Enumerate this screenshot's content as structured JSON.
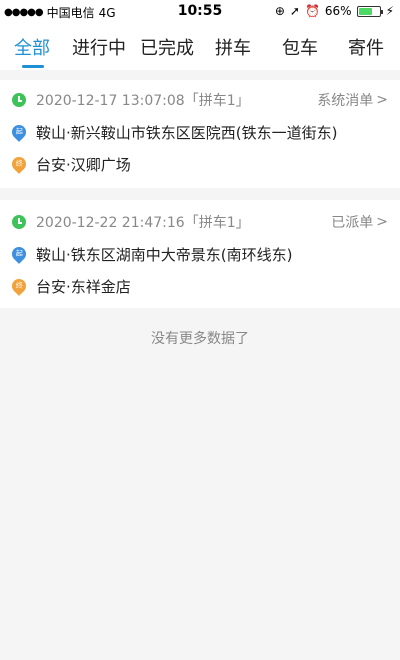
{
  "status_bar": {
    "signal_dots": "●●●●●",
    "carrier": "中国电信",
    "network": "4G",
    "time": "10:55",
    "battery": "66%",
    "battery_level": 0.66
  },
  "tabs": [
    {
      "label": "全部",
      "active": true
    },
    {
      "label": "进行中"
    },
    {
      "label": "已完成"
    },
    {
      "label": "拼车"
    },
    {
      "label": "包车"
    },
    {
      "label": "寄件"
    }
  ],
  "orders": [
    {
      "datetime": "2020-12-17 13:07:08「拼车1」",
      "status": "系统消单",
      "from": "鞍山·新兴鞍山市铁东区医院西(铁东一道街东)",
      "to": "台安·汉卿广场"
    },
    {
      "datetime": "2020-12-22 21:47:16「拼车1」",
      "status": "已派单",
      "from": "鞍山·铁东区湖南中大帝景东(南环线东)",
      "to": "台安·东祥金店"
    }
  ],
  "labels": {
    "start": "起",
    "end": "终"
  },
  "no_more": "没有更多数据了",
  "colors": {
    "accent": "#1e90d4",
    "clock": "#3ec25a",
    "start_pin": "#3d8fe0",
    "end_pin": "#f2a23a"
  }
}
